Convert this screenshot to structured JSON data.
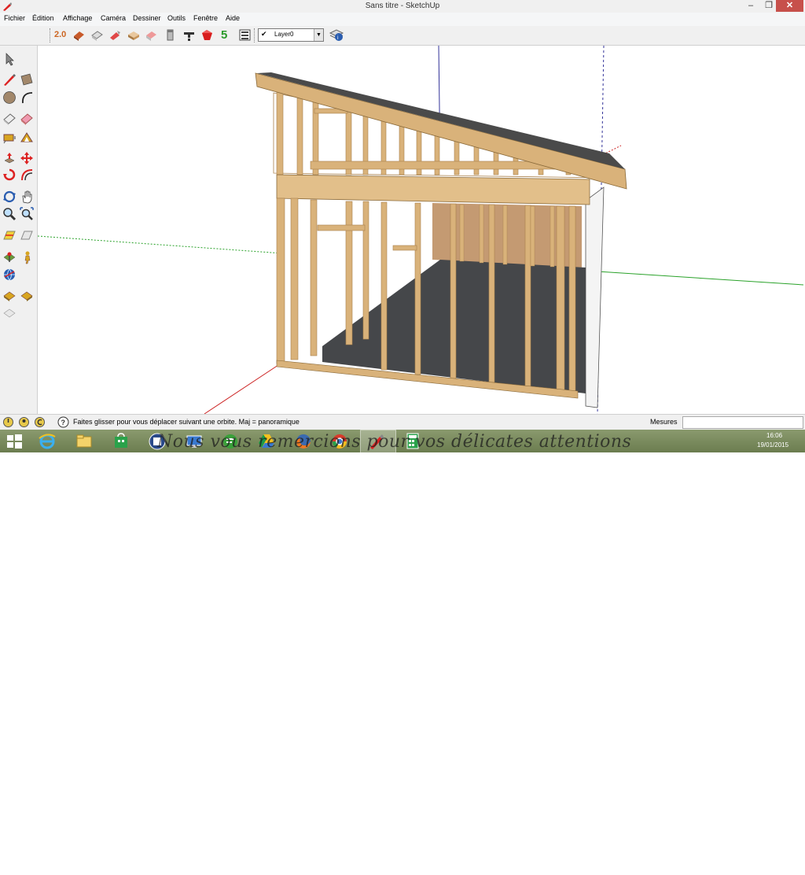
{
  "window": {
    "title": "Sans titre - SketchUp",
    "minimize": "‒",
    "maximize": "❐",
    "close": "✕"
  },
  "menu": [
    "Fichier",
    "Édition",
    "Affichage",
    "Caméra",
    "Dessiner",
    "Outils",
    "Fenêtre",
    "Aide"
  ],
  "toolbar": {
    "icons": [
      "sketchup-2-icon",
      "warehouse-icon",
      "share-model-icon",
      "extension-warehouse-icon",
      "component-icon",
      "styles-icon",
      "layer-tool-icon",
      "tap-icon",
      "red-gem-icon",
      "five-icon",
      "layers-panel-icon"
    ],
    "version_label": "2.0",
    "five_label": "5",
    "layer": {
      "checked": "✔",
      "value": "Layer0",
      "arrow": "▼"
    }
  },
  "left_toolbar": [
    "select-icon",
    "pencil-icon",
    "rectangle-icon",
    "circle-icon",
    "arc-icon",
    "eraser-icon",
    "paint-bucket-icon",
    "tape-icon",
    "protractor-icon",
    "push-pull-icon",
    "move-icon",
    "rotate-icon",
    "offset-icon",
    "orbit-icon",
    "pan-icon",
    "zoom-icon",
    "zoom-extents-icon",
    "section-icon",
    "walk-icon",
    "look-around-icon",
    "position-camera-icon",
    "globe-icon",
    "sandbox-icon",
    "sandbox2-icon",
    "sandbox3-icon"
  ],
  "status": {
    "hint": "Faites glisser pour vous déplacer suivant une orbite.  Maj = panoramique",
    "measures_label": "Mesures",
    "measures_value": ""
  },
  "taskbar": {
    "watermark": "Nous vous remercions pour vos délicates attentions",
    "time": "16:06",
    "date": "19/01/2015"
  },
  "colors": {
    "wood": "#d9b27a",
    "wood_dark": "#a9804c",
    "floor": "#45474a",
    "roof": "#4a4a4a",
    "osb": "#c49a72",
    "axis_green": "#2aa22a",
    "axis_red": "#cc2222",
    "axis_blue": "#333399"
  }
}
